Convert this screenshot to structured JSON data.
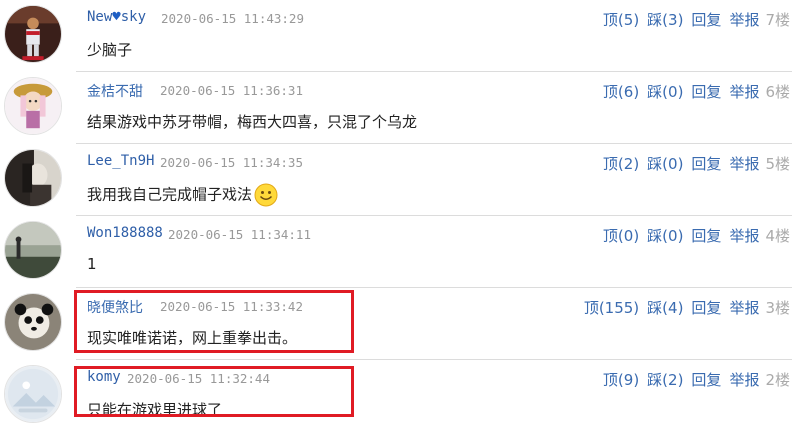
{
  "comments": [
    {
      "username_pre": "New",
      "username_post": "sky",
      "heart": "♥",
      "time": "2020-06-15 11:43:29",
      "content": "少脑子",
      "like": "顶(5)",
      "dislike": "踩(3)",
      "reply": "回复",
      "report": "举报",
      "floor": "7楼"
    },
    {
      "username": "金桔不甜",
      "time": "2020-06-15 11:36:31",
      "content": "结果游戏中苏牙带帽，梅西大四喜，只混了个乌龙",
      "like": "顶(6)",
      "dislike": "踩(0)",
      "reply": "回复",
      "report": "举报",
      "floor": "6楼"
    },
    {
      "username": "Lee_Tn9H",
      "time": "2020-06-15 11:34:35",
      "content": "我用我自己完成帽子戏法",
      "like": "顶(2)",
      "dislike": "踩(0)",
      "reply": "回复",
      "report": "举报",
      "floor": "5楼"
    },
    {
      "username": "Won188888",
      "time": "2020-06-15 11:34:11",
      "content": "1",
      "like": "顶(0)",
      "dislike": "踩(0)",
      "reply": "回复",
      "report": "举报",
      "floor": "4楼"
    },
    {
      "username": "晓便煞比",
      "time": "2020-06-15 11:33:42",
      "content": "现实唯唯诺诺，网上重拳出击。",
      "like": "顶(155)",
      "dislike": "踩(4)",
      "reply": "回复",
      "report": "举报",
      "floor": "3楼"
    },
    {
      "username": "komy",
      "time": "2020-06-15 11:32:44",
      "content": "只能在游戏里进球了",
      "like": "顶(9)",
      "dislike": "踩(2)",
      "reply": "回复",
      "report": "举报",
      "floor": "2楼"
    }
  ],
  "colors": {
    "link": "#3a6bb0",
    "timestamp": "#999999",
    "highlight_box": "#e01b24",
    "separator": "#dcdcdc"
  }
}
